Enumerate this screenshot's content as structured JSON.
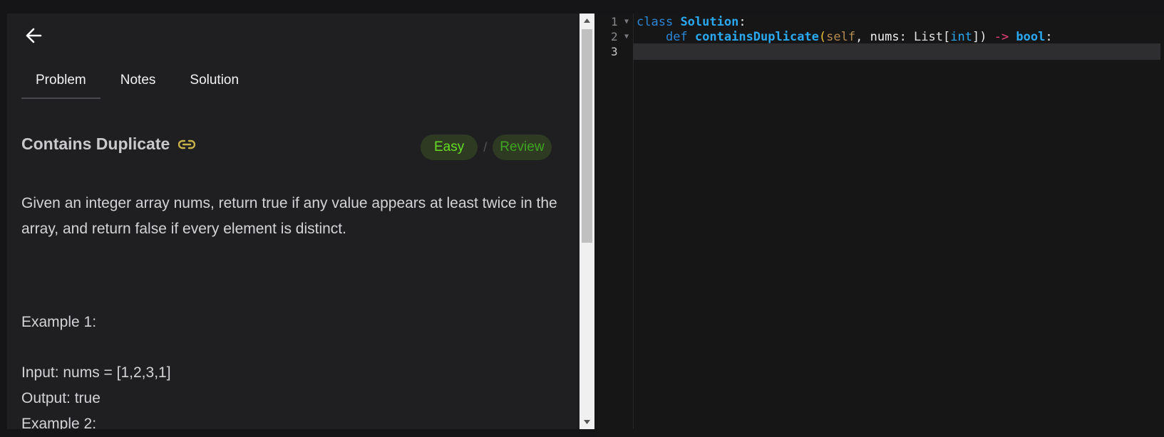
{
  "problem_panel": {
    "back_icon": "arrow-left-icon",
    "tabs": [
      {
        "label": "Problem",
        "active": true
      },
      {
        "label": "Notes",
        "active": false
      },
      {
        "label": "Solution",
        "active": false
      }
    ],
    "title": "Contains Duplicate",
    "link_icon": "link-icon",
    "difficulty": "Easy",
    "separator": "/",
    "status": "Review",
    "description": "Given an integer array nums, return true if any value appears at least twice in the array, and return false if every element is distinct.",
    "example1_heading": "Example 1:",
    "example1_input": "Input: nums = [1,2,3,1]",
    "example1_output": "Output: true",
    "example2_heading": "Example 2:"
  },
  "colors": {
    "easy_badge": "#66de24",
    "review_badge": "#3fa621",
    "badge_bg": "#2e3b22",
    "link_icon": "#c9b24a"
  },
  "editor": {
    "line_numbers": [
      "1",
      "2",
      "3"
    ],
    "line1": {
      "kw": "class",
      "name": "Solution",
      "colon": ":"
    },
    "line2": {
      "indent": "    ",
      "kw": "def",
      "fn": "containsDuplicate",
      "open": "(",
      "self": "self",
      "comma1": ", ",
      "param": "nums",
      "colon1": ": ",
      "list": "List",
      "lbr": "[",
      "int": "int",
      "rbr": "]",
      "close": ")",
      "arrow": " -> ",
      "ret": "bool",
      "colon2": ":"
    }
  }
}
